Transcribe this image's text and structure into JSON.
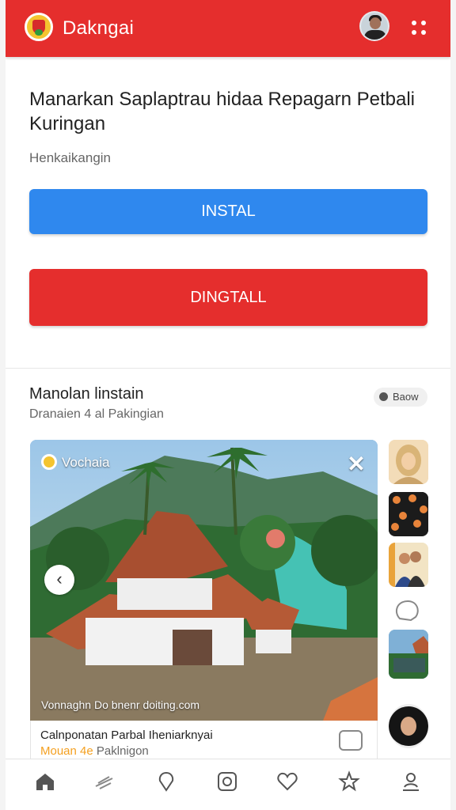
{
  "header": {
    "brand": "Dakngai",
    "accent_color": "#e52e2d",
    "logo_icon": "app-logo-icon",
    "avatar_icon": "user-avatar",
    "menu_icon": "dots-grid-icon"
  },
  "install_card": {
    "title": "Manarkan Saplaptrau hidaa Repagarn Petbali Kuringan",
    "subtitle": "Henkaikangin",
    "install_label": "INSTAL",
    "install_color": "#2f88ee",
    "uninstall_label": "DINGTALL",
    "uninstall_color": "#e52e2d"
  },
  "section": {
    "title": "Manolan linstain",
    "subtitle": "Dranaien 4 al Pakingian",
    "pill_label": "Baow"
  },
  "photo": {
    "location_label": "Vochaia",
    "credit": "Vonnaghn  Do bnenr doiting.com",
    "caption_title": "Calnponatan Parbal Iheniarknyai",
    "caption_sub_highlight": "Mouan 4e",
    "caption_sub_rest": "Paklnigon"
  },
  "nav": {
    "items": [
      "home-icon",
      "feather-icon",
      "pin-icon",
      "camera-icon",
      "heart-icon",
      "star-icon",
      "profile-icon"
    ]
  }
}
